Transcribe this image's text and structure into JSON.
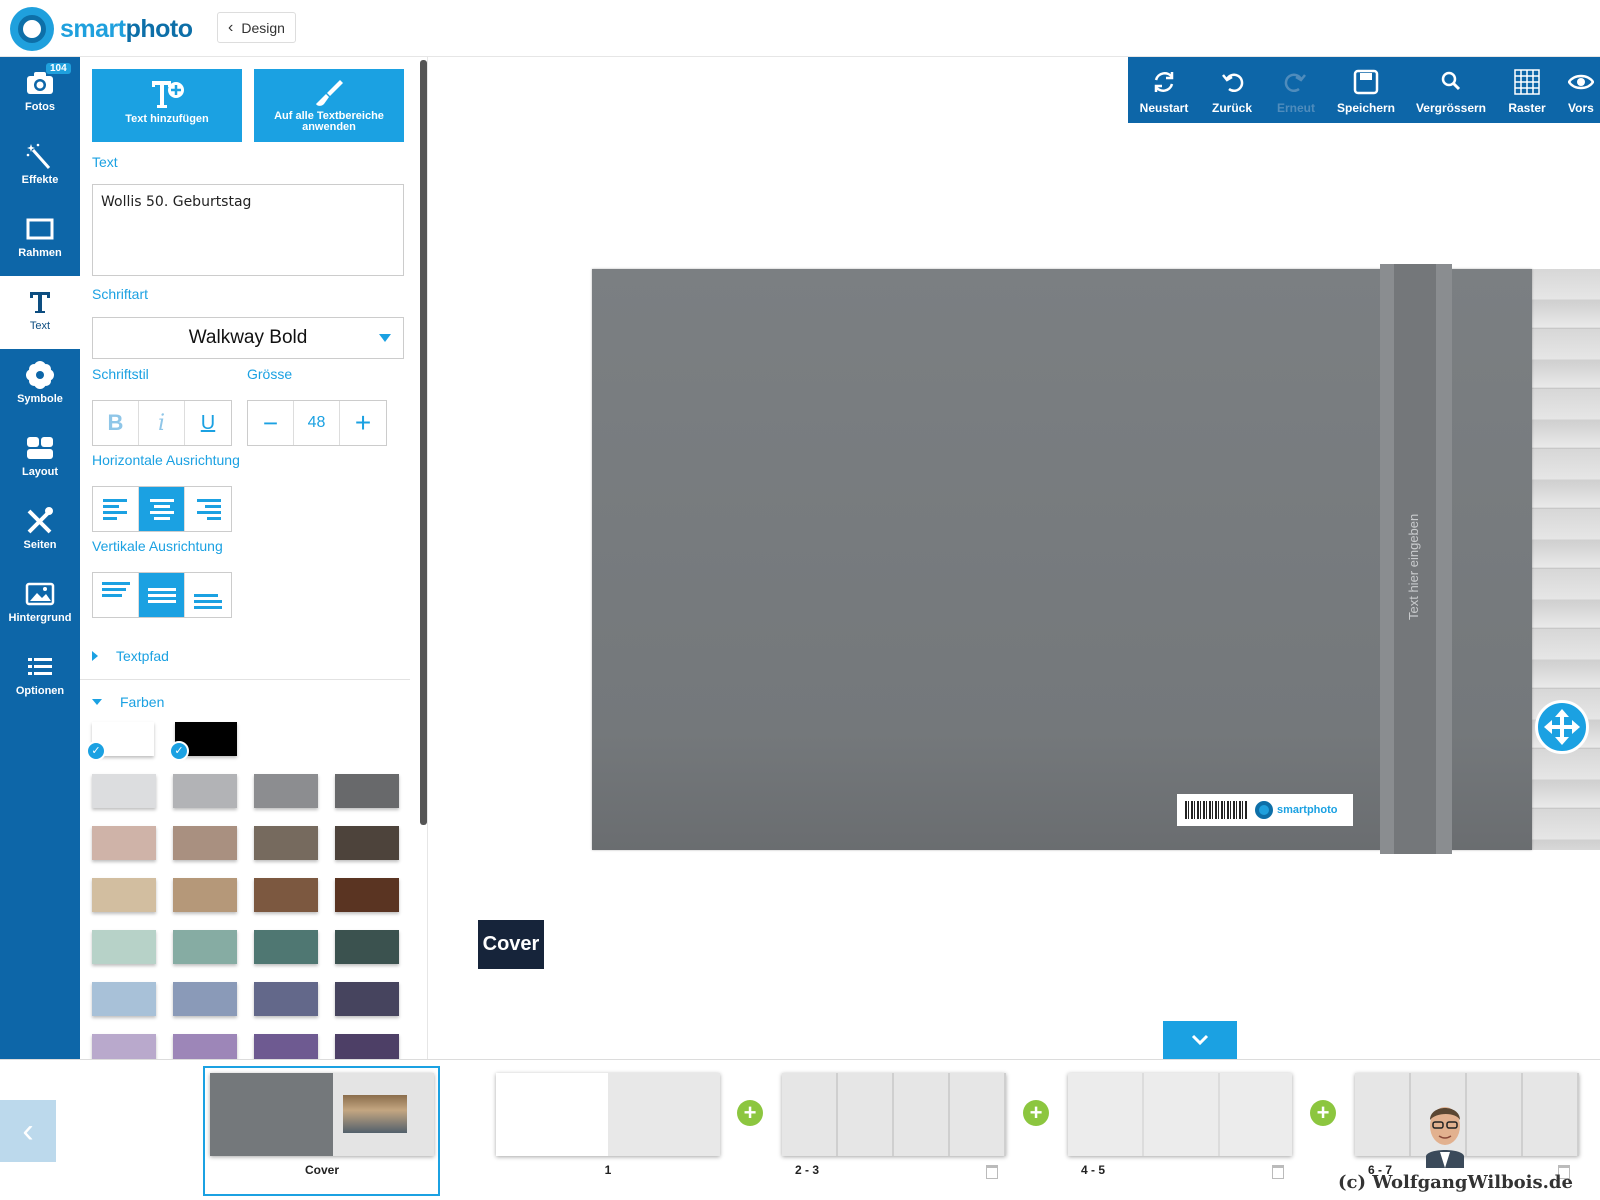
{
  "header": {
    "brand": {
      "part1": "smart",
      "part2": "photo"
    },
    "back_button": "Design"
  },
  "sidebar": {
    "items": [
      {
        "label": "Fotos",
        "icon": "camera-icon",
        "badge": "104"
      },
      {
        "label": "Effekte",
        "icon": "magic-wand-icon"
      },
      {
        "label": "Rahmen",
        "icon": "frame-icon"
      },
      {
        "label": "Text",
        "icon": "text-icon",
        "active": true
      },
      {
        "label": "Symbole",
        "icon": "flower-icon"
      },
      {
        "label": "Layout",
        "icon": "layout-icon"
      },
      {
        "label": "Seiten",
        "icon": "tools-icon"
      },
      {
        "label": "Hintergrund",
        "icon": "image-icon"
      },
      {
        "label": "Optionen",
        "icon": "list-icon"
      }
    ]
  },
  "panel": {
    "add_text": "Text hinzufügen",
    "apply_all": "Auf alle Textbereiche anwenden",
    "text_label": "Text",
    "text_value": "Wollis 50. Geburtstag",
    "font_label": "Schriftart",
    "font_value": "Walkway Bold",
    "style_label": "Schriftstil",
    "size_label": "Grösse",
    "size_value": "48",
    "style_bold": "B",
    "style_italic": "i",
    "style_underline": "U",
    "size_minus": "−",
    "size_plus": "+",
    "h_align_label": "Horizontale Ausrichtung",
    "v_align_label": "Vertikale Ausrichtung",
    "textpath_label": "Textpfad",
    "colors_label": "Farben",
    "colors_selected": [
      "#ffffff",
      "#000000"
    ],
    "palette": [
      [
        "#dcdddf",
        "#b2b3b6",
        "#8c8d90",
        "#68696b"
      ],
      [
        "#cfb3a8",
        "#a99080",
        "#766a5e",
        "#4d433b"
      ],
      [
        "#d2bea0",
        "#b59879",
        "#7c5840",
        "#5a3422"
      ],
      [
        "#b7d2c8",
        "#86aca3",
        "#4f7772",
        "#3b524f"
      ],
      [
        "#a8c1d8",
        "#8a9ab8",
        "#63688a",
        "#46445e"
      ],
      [
        "#b9a9cc",
        "#9d86b8",
        "#6e5a91",
        "#4d3f66"
      ]
    ]
  },
  "toolbar": {
    "items": [
      {
        "label": "Neustart",
        "icon": "refresh-icon"
      },
      {
        "label": "Zurück",
        "icon": "undo-icon"
      },
      {
        "label": "Erneut",
        "icon": "redo-icon",
        "disabled": true
      },
      {
        "label": "Speichern",
        "icon": "save-icon"
      },
      {
        "label": "Vergrössern",
        "icon": "zoom-icon"
      },
      {
        "label": "Raster",
        "icon": "grid-icon"
      },
      {
        "label": "Vors",
        "icon": "eye-icon"
      }
    ]
  },
  "canvas": {
    "spine_placeholder": "Text hier eingeben",
    "barcode_brand": "smartphoto",
    "page_tag": "Cover"
  },
  "filmstrip": {
    "pages": [
      {
        "label": "Cover"
      },
      {
        "label": "1"
      },
      {
        "label": "2  -  3"
      },
      {
        "label": "4  -  5"
      },
      {
        "label": "6  -  7"
      }
    ]
  },
  "watermark": "(c) WolfgangWilbois.de",
  "colors": {
    "primary": "#0d66a8",
    "accent": "#1ba1e2",
    "add": "#8cc63f"
  }
}
